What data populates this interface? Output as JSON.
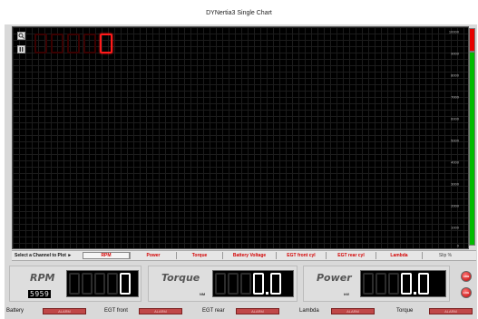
{
  "window": {
    "title": "DYNertia3 Single Chart"
  },
  "plot": {
    "big_readout_digits": [
      "",
      "",
      "",
      "",
      "0"
    ],
    "y_scale_labels": [
      "10000",
      "9000",
      "8000",
      "7000",
      "6000",
      "5000",
      "4000",
      "3000",
      "2000",
      "1000",
      "0"
    ],
    "bar_colors": {
      "red": "#e60000",
      "green": "#00bb00"
    }
  },
  "channels": {
    "prompt": "Select a Channel to Plot ►",
    "items": [
      {
        "label": "RPM",
        "selected": true
      },
      {
        "label": "Power",
        "selected": false
      },
      {
        "label": "Torque",
        "selected": false
      },
      {
        "label": "Battery Voltage",
        "selected": false
      },
      {
        "label": "EGT front cyl",
        "selected": false
      },
      {
        "label": "EGT rear cyl",
        "selected": false
      },
      {
        "label": "Lambda",
        "selected": false
      },
      {
        "label": "Slip %",
        "selected": false
      }
    ]
  },
  "gauges": {
    "rpm": {
      "title": "RPM",
      "sub_value": "5959",
      "value": "0"
    },
    "torque": {
      "title": "Torque",
      "unit": "NM",
      "value": "0.0"
    },
    "power": {
      "title": "Power",
      "unit": "kW",
      "value": "0.0"
    }
  },
  "buttons": {
    "top_label": "ARB",
    "bottom_label": "LOG"
  },
  "status": {
    "items": [
      {
        "label": "Battery",
        "value": "ALARM"
      },
      {
        "label": "EGT front",
        "value": "ALARM"
      },
      {
        "label": "EGT rear",
        "value": "ALARM"
      },
      {
        "label": "Lambda",
        "value": "ALARM"
      },
      {
        "label": "Torque",
        "value": "ALARM"
      }
    ]
  }
}
